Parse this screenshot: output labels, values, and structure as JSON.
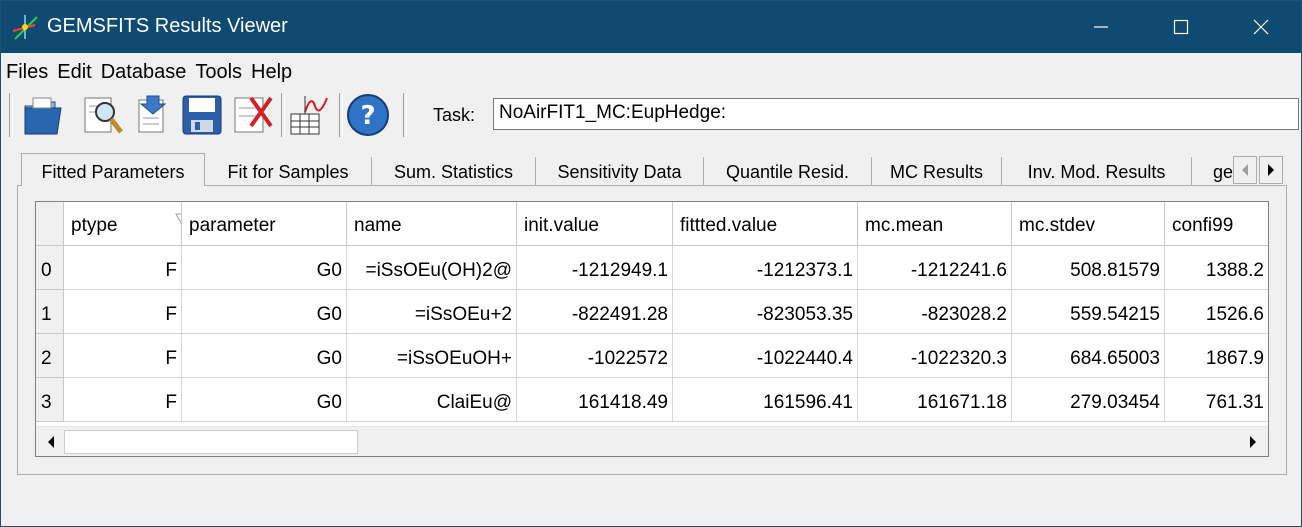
{
  "window": {
    "title": "GEMSFITS Results Viewer"
  },
  "menu": [
    "Files",
    "Edit",
    "Database",
    "Tools",
    "Help"
  ],
  "toolbar": {
    "task_label": "Task:",
    "task_value": "NoAirFIT1_MC:EupHedge:",
    "buttons": [
      "open-folder-icon",
      "search-document-icon",
      "import-document-icon",
      "save-disk-icon",
      "delete-document-icon",
      "chart-table-icon",
      "help-icon"
    ]
  },
  "tabs": [
    "Fitted Parameters",
    "Fit for Samples",
    "Sum. Statistics",
    "Sensitivity Data",
    "Quantile Resid.",
    "MC Results",
    "Inv. Mod. Results",
    "ge"
  ],
  "table": {
    "columns": [
      "ptype",
      "parameter",
      "name",
      "init.value",
      "fittted.value",
      "mc.mean",
      "mc.stdev",
      "confi99"
    ],
    "row_headers": [
      "0",
      "1",
      "2",
      "3"
    ],
    "rows": [
      [
        "F",
        "G0",
        "=iSsOEu(OH)2@",
        "-1212949.1",
        "-1212373.1",
        "-1212241.6",
        "508.81579",
        "1388.2"
      ],
      [
        "F",
        "G0",
        "=iSsOEu+2",
        "-822491.28",
        "-823053.35",
        "-823028.2",
        "559.54215",
        "1526.6"
      ],
      [
        "F",
        "G0",
        "=iSsOEuOH+",
        "-1022572",
        "-1022440.4",
        "-1022320.3",
        "684.65003",
        "1867.9"
      ],
      [
        "F",
        "G0",
        "ClaiEu@",
        "161418.49",
        "161596.41",
        "161671.18",
        "279.03454",
        "761.31"
      ]
    ]
  },
  "colors": {
    "titlebar": "#0e4a72",
    "window_bg": "#f0f0f0"
  }
}
